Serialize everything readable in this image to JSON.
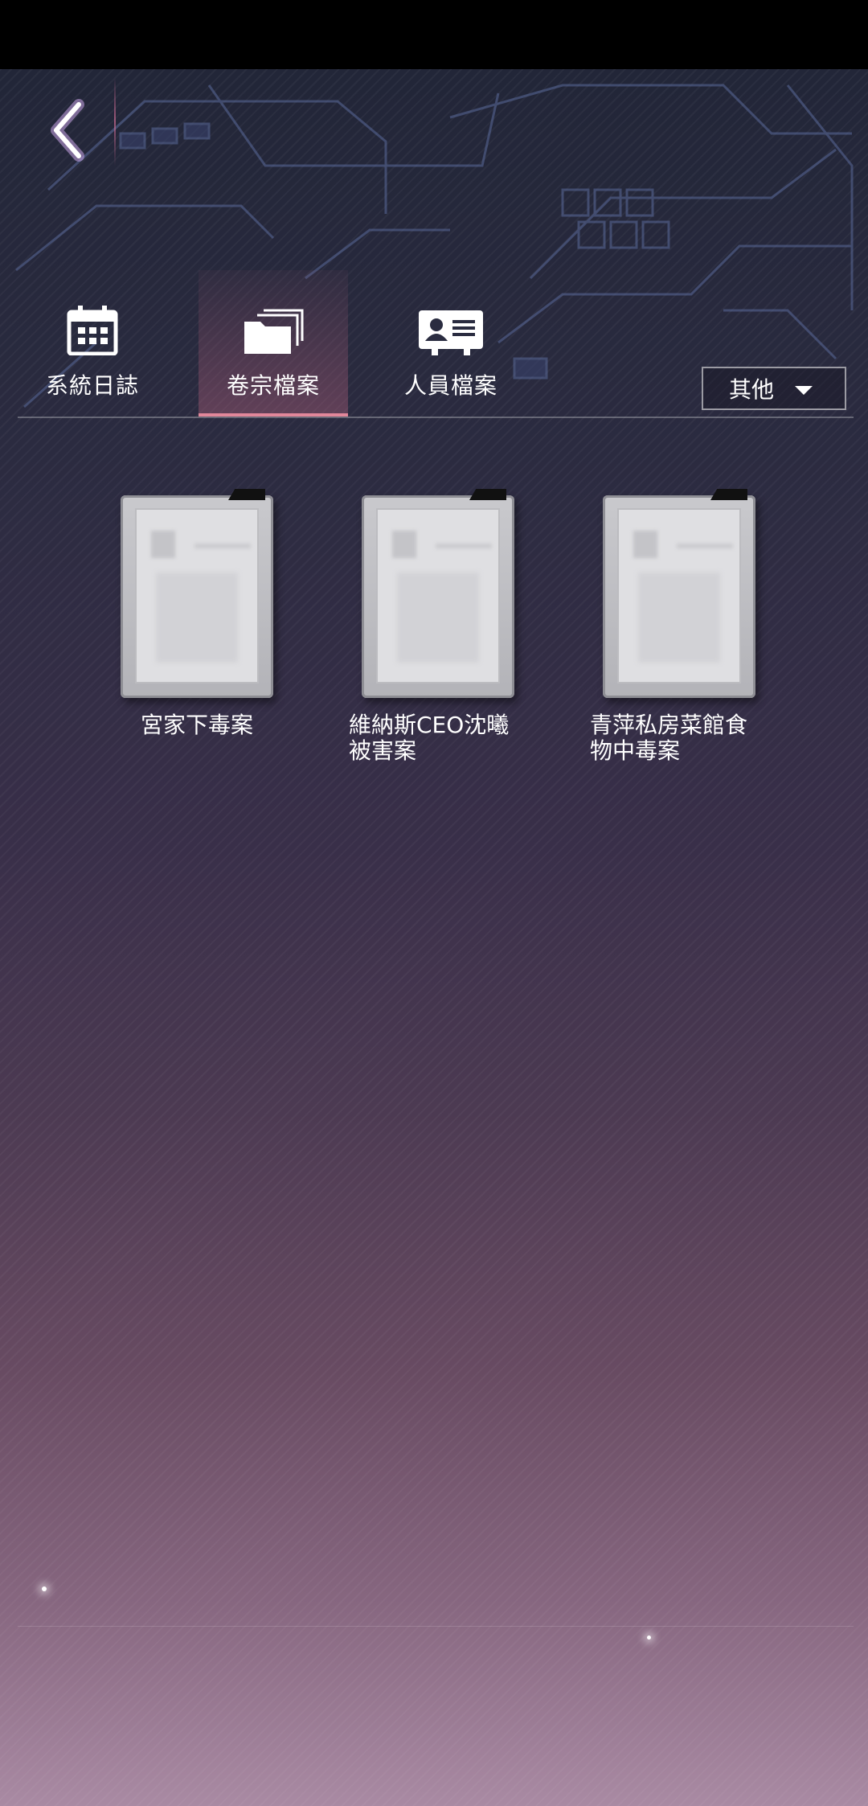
{
  "tabs": [
    {
      "label": "系統日誌",
      "icon": "calendar-icon",
      "active": false
    },
    {
      "label": "卷宗檔案",
      "icon": "folders-icon",
      "active": true
    },
    {
      "label": "人員檔案",
      "icon": "id-card-icon",
      "active": false
    }
  ],
  "dropdown": {
    "selected": "其他"
  },
  "files": [
    {
      "name": "宮家下毒案"
    },
    {
      "name": "維納斯CEO沈曦被害案"
    },
    {
      "name": "青萍私房菜館食物中毒案"
    }
  ],
  "colors": {
    "accent": "#e2879a",
    "background_top": "#222638",
    "background_bottom": "#a98aa3"
  }
}
